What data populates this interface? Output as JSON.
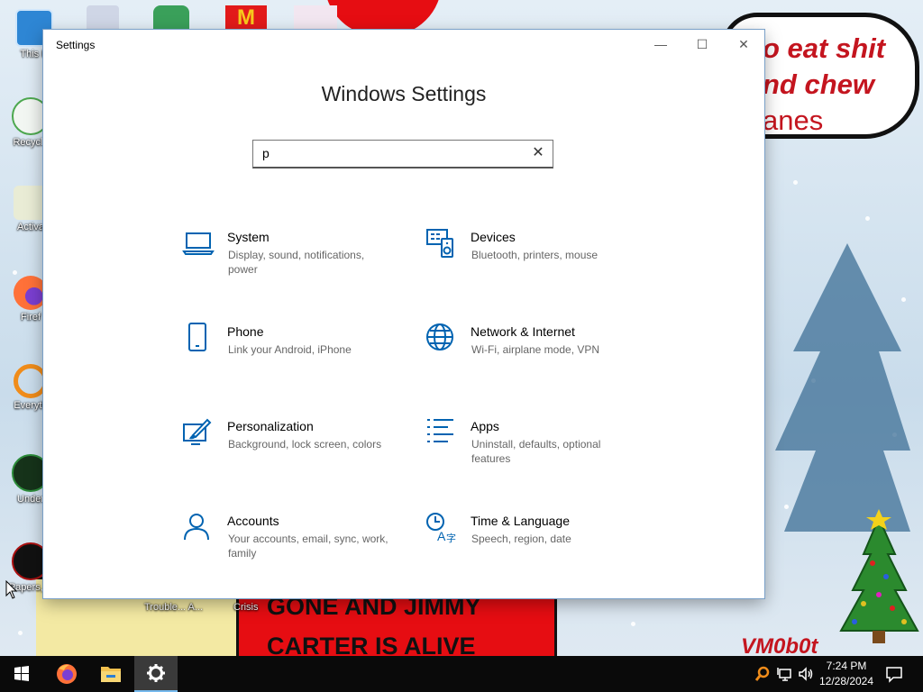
{
  "desktop": {
    "speech_text": [
      "o eat shit",
      "nd chew",
      "anes"
    ],
    "shirt_text": [
      "GONE AND JIMMY",
      "CARTER IS ALIVE"
    ],
    "signature": "VM0b0t",
    "icons": [
      {
        "label": "This P"
      },
      {
        "label": "Recycle"
      },
      {
        "label": "Activa"
      },
      {
        "label": "Firef"
      },
      {
        "label": "Everyth"
      },
      {
        "label": "Under"
      },
      {
        "label": "Papers, P"
      },
      {
        "label": "Trouble... A..."
      },
      {
        "label": "Crisis"
      }
    ]
  },
  "window": {
    "title": "Settings",
    "controls": {
      "minimize": "—",
      "maximize": "☐",
      "close": "✕"
    },
    "heading": "Windows Settings",
    "search": {
      "value": "p",
      "clear": "✕"
    },
    "tiles": [
      {
        "name": "System",
        "desc": "Display, sound, notifications, power",
        "icon": "laptop-icon"
      },
      {
        "name": "Devices",
        "desc": "Bluetooth, printers, mouse",
        "icon": "keyboard-speaker-icon"
      },
      {
        "name": "Phone",
        "desc": "Link your Android, iPhone",
        "icon": "phone-icon"
      },
      {
        "name": "Network & Internet",
        "desc": "Wi-Fi, airplane mode, VPN",
        "icon": "globe-icon"
      },
      {
        "name": "Personalization",
        "desc": "Background, lock screen, colors",
        "icon": "paint-icon"
      },
      {
        "name": "Apps",
        "desc": "Uninstall, defaults, optional features",
        "icon": "apps-list-icon"
      },
      {
        "name": "Accounts",
        "desc": "Your accounts, email, sync, work, family",
        "icon": "person-icon"
      },
      {
        "name": "Time & Language",
        "desc": "Speech, region, date",
        "icon": "time-language-icon"
      }
    ]
  },
  "taskbar": {
    "apps": [
      "start-icon",
      "firefox-icon",
      "file-explorer-icon",
      "settings-gear-icon"
    ],
    "time": "7:24 PM",
    "date": "12/28/2024"
  },
  "colors": {
    "accent": "#0063b1",
    "taskbar": "#0a0a0a",
    "wallpaper_red": "#e60d12"
  }
}
